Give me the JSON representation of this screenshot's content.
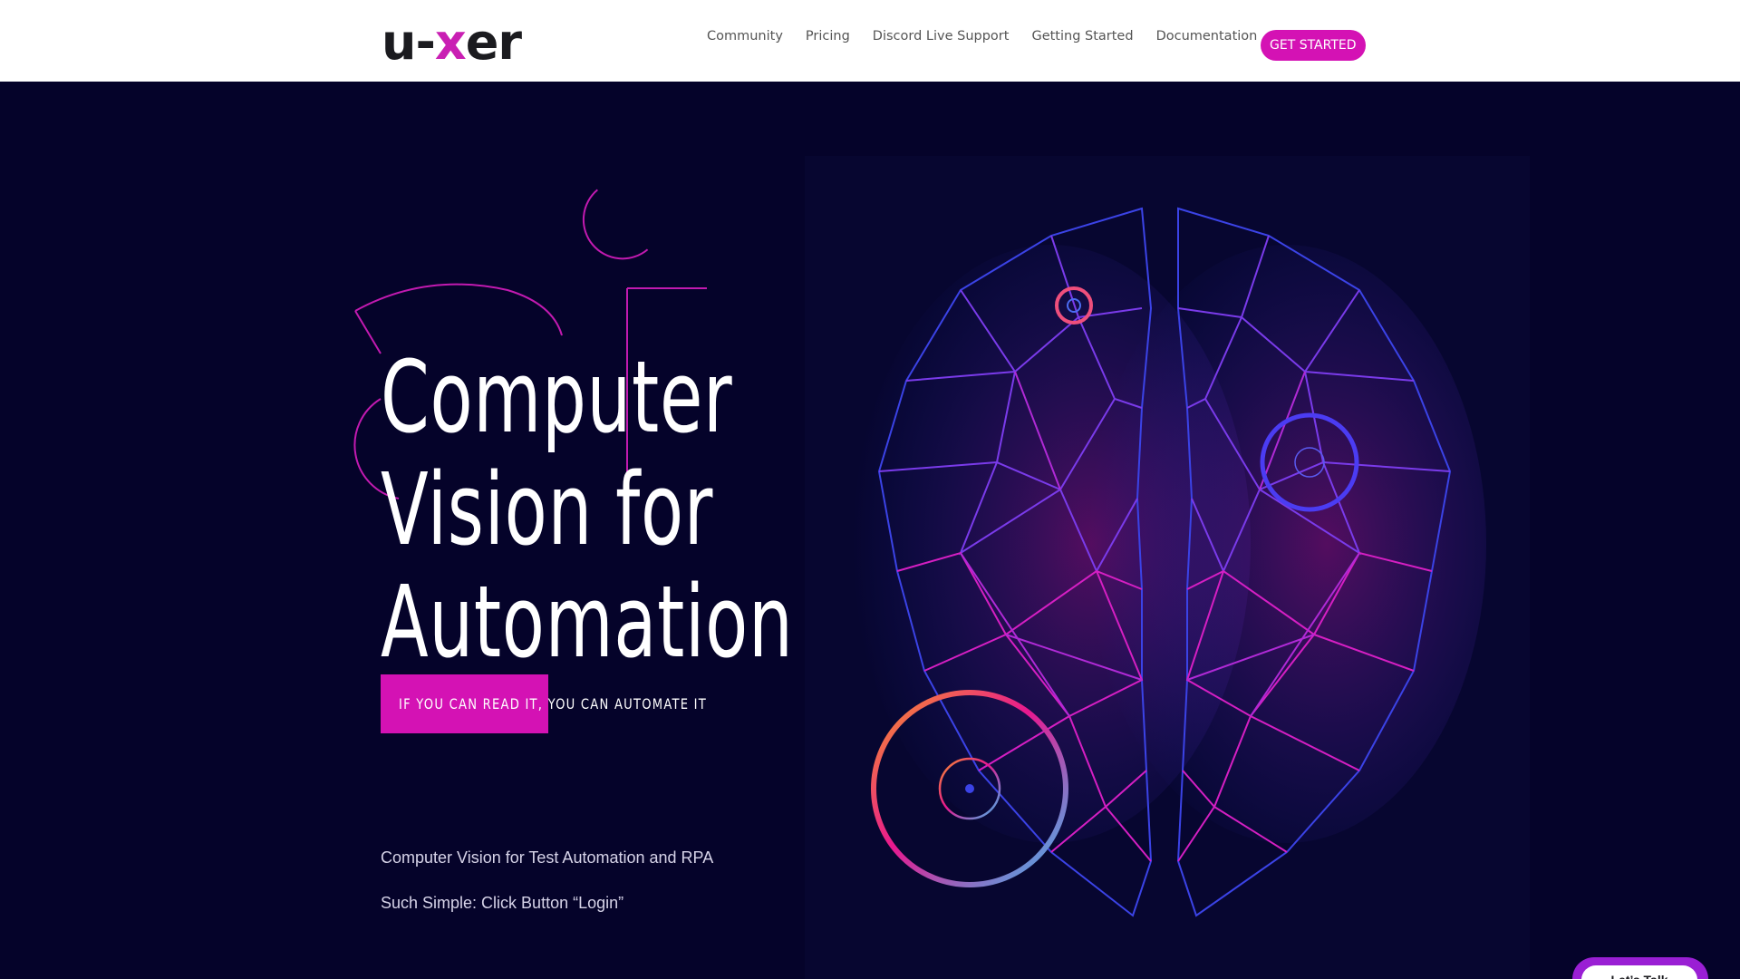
{
  "header": {
    "logo": {
      "left": "u-",
      "x": "x",
      "right": "er"
    },
    "nav": [
      "Community",
      "Pricing",
      "Discord Live Support",
      "Getting Started",
      "Documentation"
    ],
    "cta_label": "GET STARTED"
  },
  "hero": {
    "headline": [
      "Computer",
      "Vision for",
      "Automation"
    ],
    "tagline": "IF YOU CAN READ IT, YOU CAN AUTOMATE IT",
    "subtext": [
      "Computer Vision for Test Automation and RPA",
      "Such Simple: Click Button “Login”"
    ]
  },
  "chat": {
    "label": "Let’s Talk"
  },
  "colors": {
    "background": "#05032a",
    "accent": "#d412b4",
    "chat": "#9a1fd4",
    "header": "#ffffff"
  },
  "icons": [
    "brain-network-illustration",
    "target-ring-icon"
  ]
}
